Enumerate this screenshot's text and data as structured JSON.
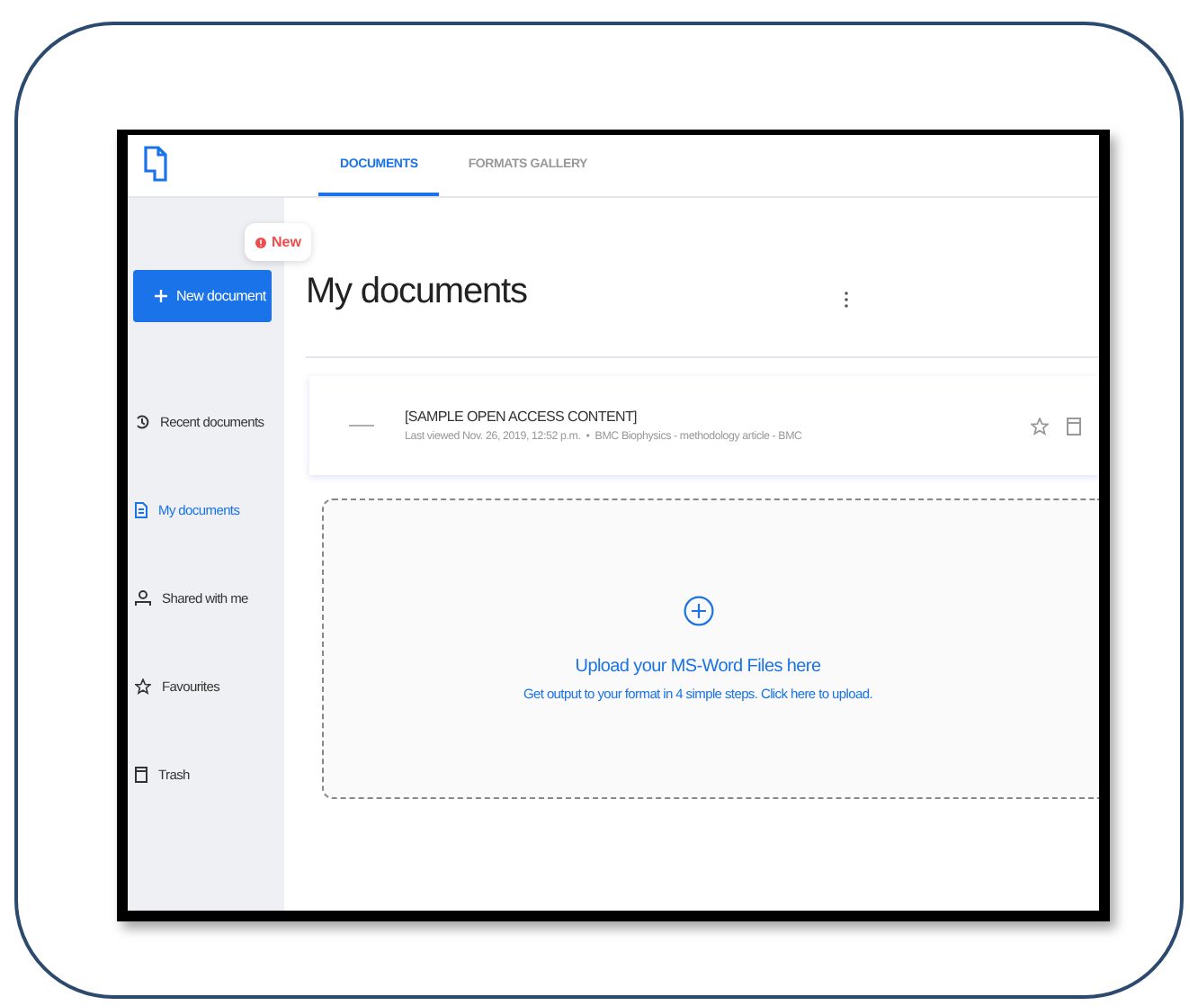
{
  "tabs": [
    {
      "label": "DOCUMENTS",
      "selected": true
    },
    {
      "label": "FORMATS GALLERY",
      "selected": false
    }
  ],
  "sidebar": {
    "badge": "New",
    "new_button": "New document",
    "items": [
      {
        "label": "Recent documents",
        "selected": false
      },
      {
        "label": "My documents",
        "selected": true
      },
      {
        "label": "Shared with me",
        "selected": false
      },
      {
        "label": "Favourites",
        "selected": false
      },
      {
        "label": "Trash",
        "selected": false
      }
    ]
  },
  "main": {
    "title": "My documents",
    "document": {
      "title": "[SAMPLE OPEN ACCESS CONTENT]",
      "meta": "Last viewed Nov. 26, 2019, 12:52 p.m.  •  BMC Biophysics - methodology article - BMC"
    },
    "upload": {
      "title": "Upload your MS-Word Files here",
      "subtitle": "Get output to your format in 4 simple steps. Click here to upload."
    }
  }
}
